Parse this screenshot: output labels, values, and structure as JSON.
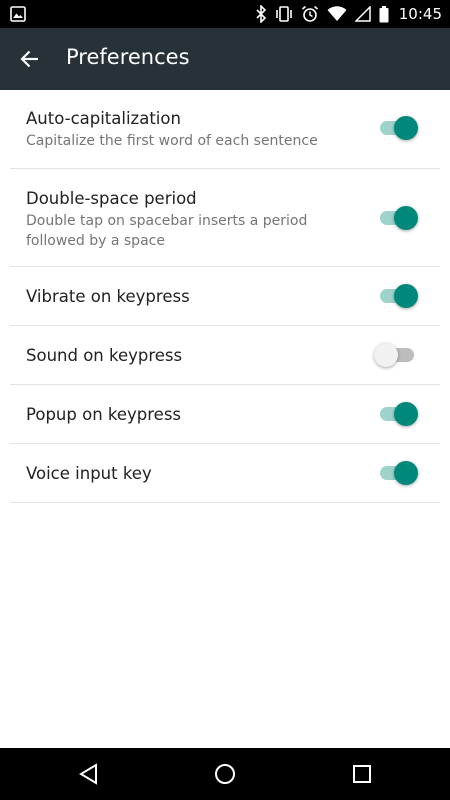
{
  "status_bar": {
    "time": "10:45",
    "icons": [
      "image-icon",
      "bluetooth-icon",
      "vibrate-icon",
      "alarm-icon",
      "wifi-icon",
      "signal-icon",
      "battery-icon"
    ]
  },
  "app_bar": {
    "title": "Preferences",
    "background": "#263238"
  },
  "accent_color": "#00897b",
  "preferences": [
    {
      "title": "Auto-capitalization",
      "summary": "Capitalize the first word of each sentence",
      "enabled": true
    },
    {
      "title": "Double-space period",
      "summary": "Double tap on spacebar inserts a period followed by a space",
      "enabled": true
    },
    {
      "title": "Vibrate on keypress",
      "summary": "",
      "enabled": true
    },
    {
      "title": "Sound on keypress",
      "summary": "",
      "enabled": false
    },
    {
      "title": "Popup on keypress",
      "summary": "",
      "enabled": true
    },
    {
      "title": "Voice input key",
      "summary": "",
      "enabled": true
    }
  ],
  "nav_bar": {
    "buttons": [
      "back-triangle-icon",
      "home-circle-icon",
      "recents-square-icon"
    ]
  }
}
